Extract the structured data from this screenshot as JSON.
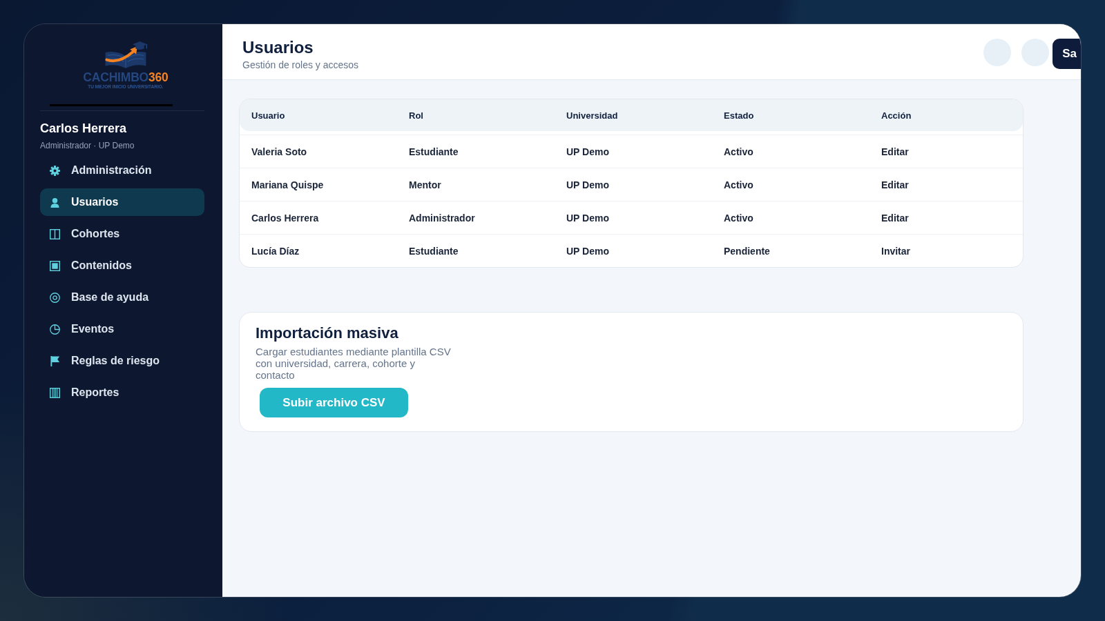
{
  "sidebar": {
    "logo": {
      "wordmark": "CACHIMBO",
      "number": "360",
      "tagline": "TU MEJOR INICIO UNIVERSITARIO."
    },
    "user": {
      "name": "Carlos Herrera",
      "meta": "Administrador · UP Demo"
    },
    "nav": [
      {
        "label": "Administración",
        "selected": false
      },
      {
        "label": "Usuarios",
        "selected": true
      },
      {
        "label": "Cohortes",
        "selected": false
      },
      {
        "label": "Contenidos",
        "selected": false
      },
      {
        "label": "Base de ayuda",
        "selected": false
      },
      {
        "label": "Eventos",
        "selected": false
      },
      {
        "label": "Reglas de riesgo",
        "selected": false
      },
      {
        "label": "Reportes",
        "selected": false
      }
    ]
  },
  "header": {
    "title": "Usuarios",
    "subtitle": "Gestión de roles y accesos",
    "actions": [
      {
        "kind": "circle"
      },
      {
        "kind": "circle"
      },
      {
        "kind": "text",
        "label": "Sa"
      }
    ]
  },
  "users_table": {
    "columns": [
      "Usuario",
      "Rol",
      "Universidad",
      "Estado",
      "Acción"
    ],
    "rows": [
      [
        "Valeria Soto",
        "Estudiante",
        "UP Demo",
        "Activo",
        "Editar"
      ],
      [
        "Mariana Quispe",
        "Mentor",
        "UP Demo",
        "Activo",
        "Editar"
      ],
      [
        "Carlos Herrera",
        "Administrador",
        "UP Demo",
        "Activo",
        "Editar"
      ],
      [
        "Lucía Díaz",
        "Estudiante",
        "UP Demo",
        "Pendiente",
        "Invitar"
      ]
    ]
  },
  "import_card": {
    "title": "Importación masiva",
    "description": "Cargar estudiantes mediante plantilla CSV con universidad, carrera, cohorte y contacto",
    "button": "Subir archivo CSV"
  }
}
